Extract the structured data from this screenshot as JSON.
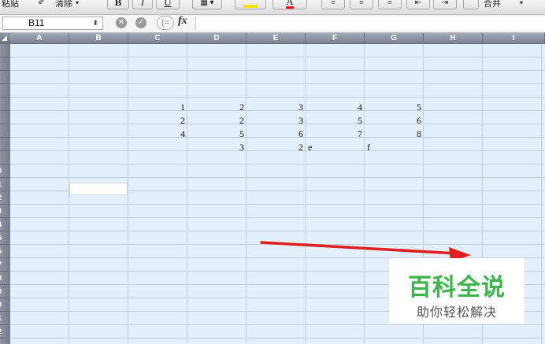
{
  "toolbar": {
    "paste_label": "粘贴",
    "clear_label": "清除",
    "bold_label": "B",
    "italic_label": "I",
    "underline_label": "U",
    "font_color_label": "A",
    "merge_label": "合并"
  },
  "formula_bar": {
    "name_box": "B11",
    "stepper": "⬍",
    "cancel_icon": "✕",
    "confirm_icon": "✓",
    "paren_label": "(=",
    "fx_label": "fx",
    "formula_value": ""
  },
  "columns": [
    "A",
    "B",
    "C",
    "D",
    "E",
    "F",
    "G",
    "H",
    "I"
  ],
  "rows": [
    "",
    "",
    "",
    "",
    "",
    "",
    "",
    "",
    "",
    "0",
    "1",
    "2",
    "3",
    "4",
    "5",
    "6",
    "7",
    "8",
    "9",
    "0",
    "1",
    "2"
  ],
  "cells": {
    "C8": "1",
    "D8": "2",
    "E8": "3",
    "F8": "4",
    "G8": "5",
    "C9": "2",
    "D9": "2",
    "E9": "3",
    "F9": "5",
    "G9": "6",
    "C10": "4",
    "D10": "5",
    "E10": "6",
    "F10": "7",
    "G10": "8",
    "D11": "3",
    "E11": "2",
    "F11a": "e",
    "F11b": "f"
  },
  "watermark": {
    "title": "百科全说",
    "subtitle": "助你轻松解决"
  },
  "colors": {
    "grid_bg": "#e3effb",
    "arrow": "#e02020",
    "watermark_green": "#3cb54a"
  }
}
